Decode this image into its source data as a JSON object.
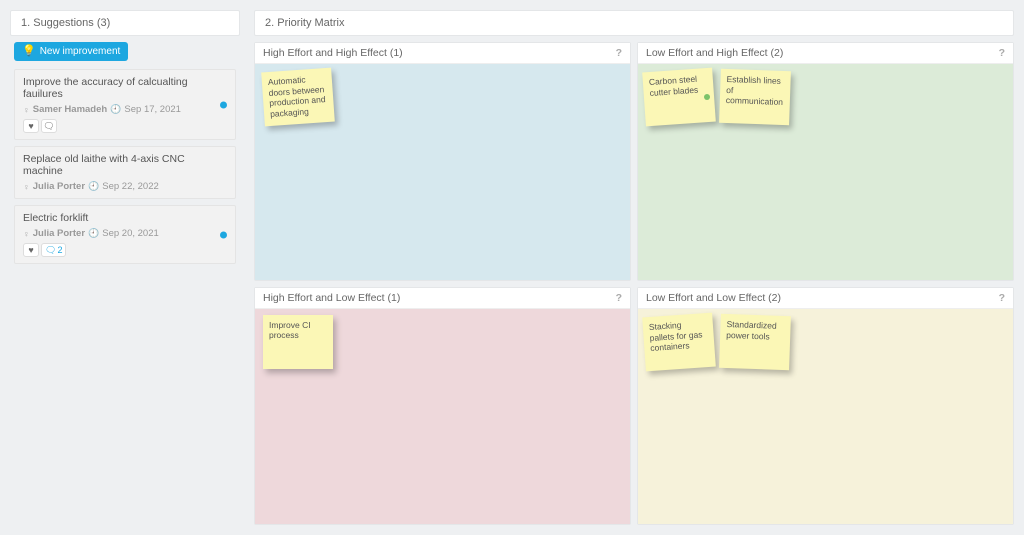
{
  "sidebar": {
    "header": "1. Suggestions (3)",
    "new_button": "New improvement",
    "items": [
      {
        "title": "Improve the accuracy of calcualting fauilures",
        "author": "Samer Hamadeh",
        "date": "Sep 17, 2021",
        "has_blue_dot": true,
        "comments": ""
      },
      {
        "title": "Replace old laithe with 4-axis CNC machine",
        "author": "Julia Porter",
        "date": "Sep 22, 2022",
        "has_blue_dot": false,
        "comments": ""
      },
      {
        "title": "Electric forklift",
        "author": "Julia Porter",
        "date": "Sep 20, 2021",
        "has_blue_dot": true,
        "comments": "2"
      }
    ]
  },
  "matrix": {
    "header": "2. Priority Matrix",
    "quadrants": {
      "q1": {
        "label": "High Effort and High Effect (1)",
        "color": "quad-blue",
        "notes": [
          {
            "text": "Automatic doors between production and packaging"
          }
        ]
      },
      "q2": {
        "label": "Low Effort and High Effect (2)",
        "color": "quad-green",
        "notes": [
          {
            "text": "Carbon steel cutter blades"
          },
          {
            "text": "Establish lines of communication"
          }
        ],
        "green_dot": true
      },
      "q3": {
        "label": "High Effort and Low Effect (1)",
        "color": "quad-pink",
        "notes": [
          {
            "text": "Improve CI process"
          }
        ]
      },
      "q4": {
        "label": "Low Effort and Low Effect (2)",
        "color": "quad-yellow",
        "notes": [
          {
            "text": "Stacking pallets for gas containers"
          },
          {
            "text": "Standardized power tools"
          }
        ]
      }
    }
  }
}
